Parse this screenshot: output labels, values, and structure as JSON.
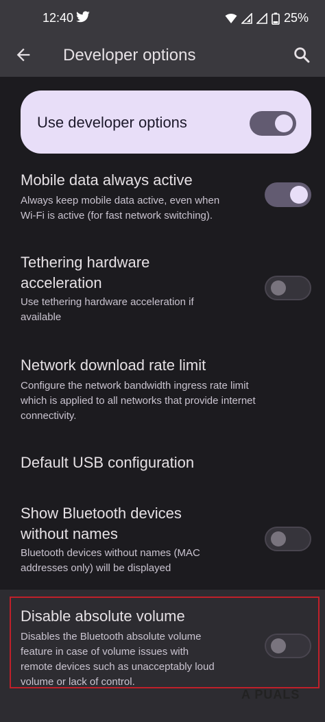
{
  "status_bar": {
    "time": "12:40",
    "battery": "25%"
  },
  "app_bar": {
    "title": "Developer options"
  },
  "master_toggle": {
    "label": "Use developer options",
    "on": true
  },
  "settings": [
    {
      "title_lines": [
        "Mobile data always active"
      ],
      "summary_lines": [
        "Always keep mobile data active, even when",
        "Wi-Fi is active (for fast network switching)."
      ],
      "toggle": "on"
    },
    {
      "title_lines": [
        "Tethering hardware",
        "acceleration"
      ],
      "summary_lines": [
        "Use tethering hardware acceleration if",
        "available"
      ],
      "toggle": "off"
    },
    {
      "title_lines": [
        "Network download rate limit"
      ],
      "summary_lines": [
        "Configure the network bandwidth ingress rate limit",
        "which is applied to all networks that provide internet",
        "connectivity."
      ],
      "toggle": null
    },
    {
      "title_lines": [
        "Default USB configuration"
      ],
      "summary_lines": [],
      "toggle": null
    },
    {
      "title_lines": [
        "Show Bluetooth devices",
        "without names"
      ],
      "summary_lines": [
        "Bluetooth devices without names (MAC",
        "addresses only) will be displayed"
      ],
      "toggle": "off"
    },
    {
      "title_lines": [
        "Disable absolute volume"
      ],
      "summary_lines": [
        "Disables the Bluetooth absolute volume",
        "feature in case of volume issues with",
        "remote devices such as unacceptably loud",
        "volume or lack of control."
      ],
      "toggle": "off"
    }
  ],
  "watermark": "A PUALS",
  "colors": {
    "highlight_border": "#c0202a",
    "accent": "#e8def8"
  }
}
